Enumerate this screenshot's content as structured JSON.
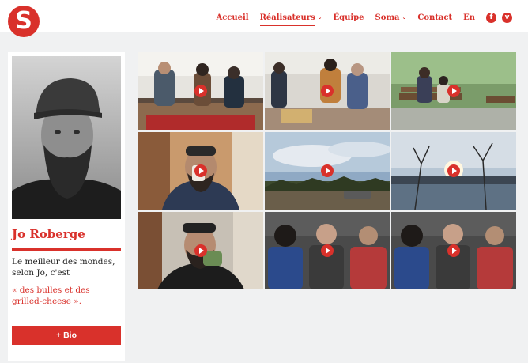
{
  "header": {
    "logo_letter": "S",
    "nav": [
      {
        "label": "Accueil",
        "has_dropdown": false,
        "active": false
      },
      {
        "label": "Réalisateurs",
        "has_dropdown": true,
        "active": true
      },
      {
        "label": "Équipe",
        "has_dropdown": false,
        "active": false
      },
      {
        "label": "Soma",
        "has_dropdown": true,
        "active": false
      },
      {
        "label": "Contact",
        "has_dropdown": false,
        "active": false
      },
      {
        "label": "En",
        "has_dropdown": false,
        "active": false
      }
    ],
    "social": [
      {
        "icon": "facebook-icon",
        "glyph": "f"
      },
      {
        "icon": "vimeo-icon",
        "glyph": "v"
      }
    ]
  },
  "profile": {
    "name": "Jo Roberge",
    "tagline": "Le meilleur des mondes, selon Jo, c'est",
    "quote": "« des bulles et des grilled-cheese ».",
    "bio_button": "+ Bio"
  },
  "colors": {
    "accent": "#d9312b",
    "page_bg": "#f0f1f2"
  },
  "videos": [
    {
      "scene": "kitchen-group"
    },
    {
      "scene": "kitchen-table"
    },
    {
      "scene": "park-bench"
    },
    {
      "scene": "man-drinking"
    },
    {
      "scene": "sky-clearing"
    },
    {
      "scene": "sunset-lake"
    },
    {
      "scene": "man-kitchen-cup"
    },
    {
      "scene": "band-lineup"
    },
    {
      "scene": "band-lineup-2"
    }
  ]
}
